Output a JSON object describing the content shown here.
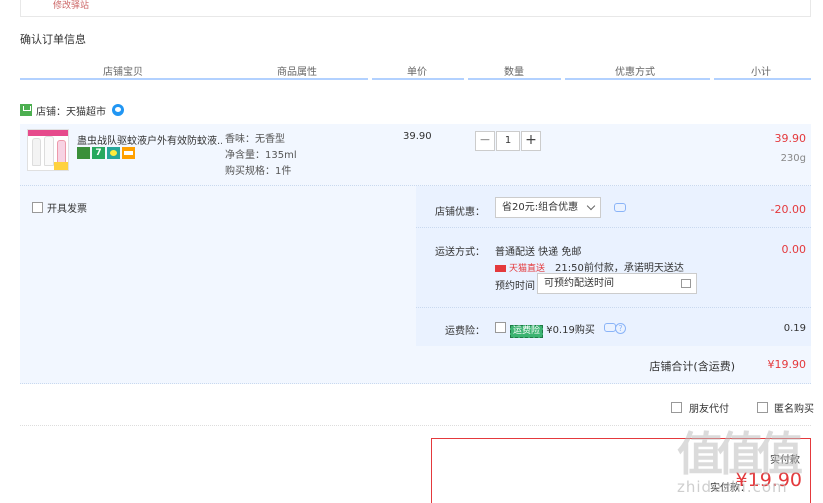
{
  "address": {
    "modify_link": "修改驿站"
  },
  "section_title": "确认订单信息",
  "columns": [
    "店铺宝贝",
    "商品属性",
    "单价",
    "数量",
    "优惠方式",
    "小计"
  ],
  "shop": {
    "label": "店铺：天猫超市"
  },
  "item": {
    "title": "蛊虫战队驱蚊液户外有效防蚊液...",
    "props": [
      "香味：无香型",
      "净含量：135ml",
      "购买规格：1件"
    ],
    "unit_price": "39.90",
    "quantity": "1",
    "minus": "−",
    "plus": "+",
    "subtotal": "39.90",
    "weight": "230g"
  },
  "invoice": {
    "label": "开具发票"
  },
  "discount": {
    "label": "店铺优惠：",
    "selected": "省20元:组合优惠",
    "value": "-20.00"
  },
  "shipping": {
    "label": "运送方式：",
    "line1": "普通配送 快递 免邮",
    "tmall_tag": "天猫直送",
    "promise": "21:50前付款，承诺明天送达",
    "reserve_label": "预约时间",
    "reserve_placeholder": "可预约配送时间",
    "value": "0.00"
  },
  "insurance": {
    "label": "运费险：",
    "tag": "运费险",
    "price": "¥0.19购买",
    "value": "0.19"
  },
  "store_total": {
    "label": "店铺合计(含运费)",
    "value": "¥19.90"
  },
  "extra": {
    "friend_pay": "朋友代付",
    "anonymous": "匿名购买"
  },
  "pay_panel": {
    "small": "实付款",
    "label": "实付款：",
    "amount": "¥19.90"
  },
  "watermark": {
    "glyphs": "值值值",
    "url": "zhidezhi.com"
  },
  "colors": {
    "price_red": "#e4393c",
    "header_blue": "#b2d1ff",
    "row_bg": "#f2f7ff"
  }
}
